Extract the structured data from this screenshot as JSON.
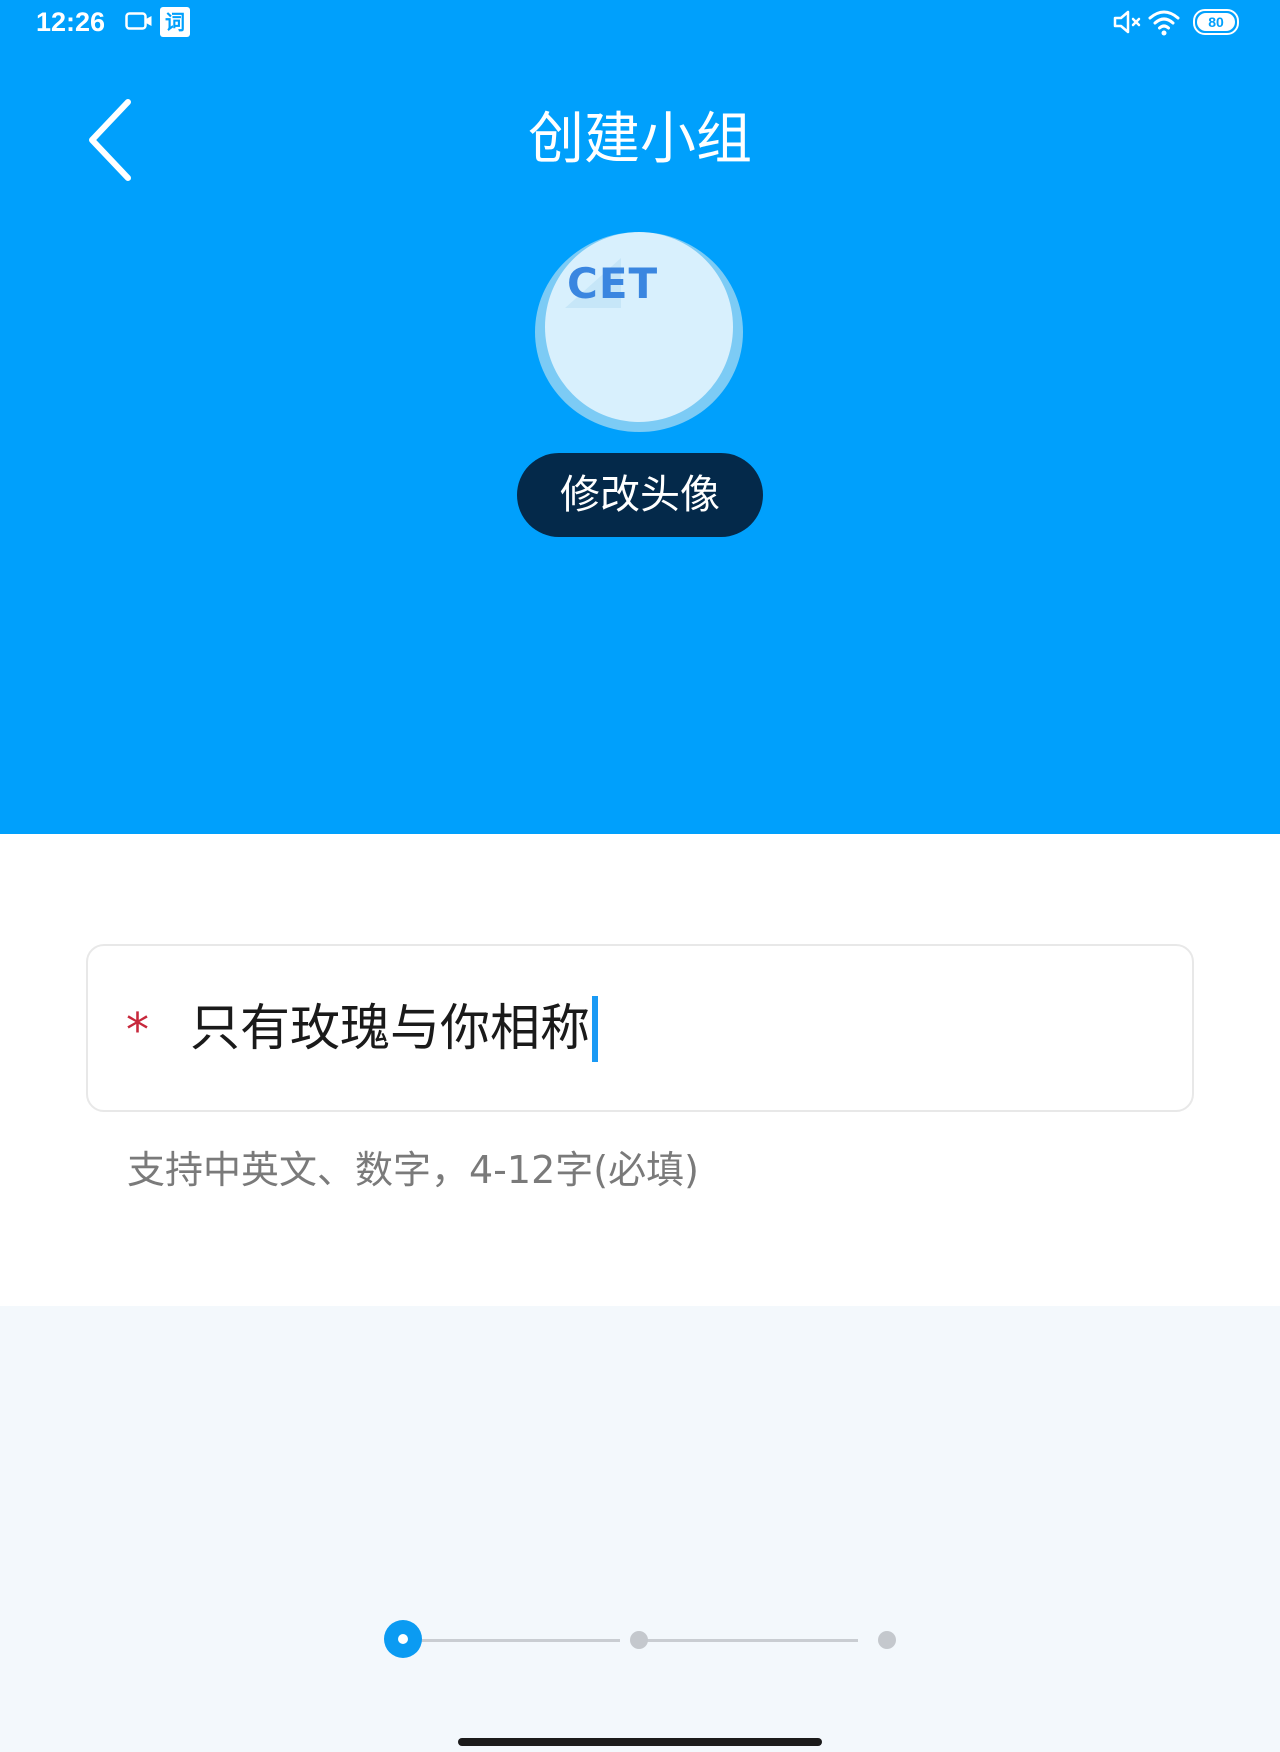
{
  "status_bar": {
    "time": "12:26",
    "app_icon_char": "词",
    "battery_level": "80",
    "icons": [
      "video-icon",
      "dict-app-icon",
      "mute-icon",
      "wifi-icon",
      "battery-icon"
    ]
  },
  "header": {
    "title": "创建小组",
    "back_icon": "chevron-left-icon",
    "background_color": "#00a0fc"
  },
  "avatar": {
    "text": "CET",
    "change_button_label": "修改头像"
  },
  "form": {
    "name_field": {
      "required_mark": "*",
      "value": "只有玫瑰与你相称"
    },
    "hint": "支持中英文、数字，4-12字(必填)"
  },
  "stepper": {
    "total_steps": 3,
    "current_step": 1,
    "accent_color": "#0b9bf2"
  }
}
